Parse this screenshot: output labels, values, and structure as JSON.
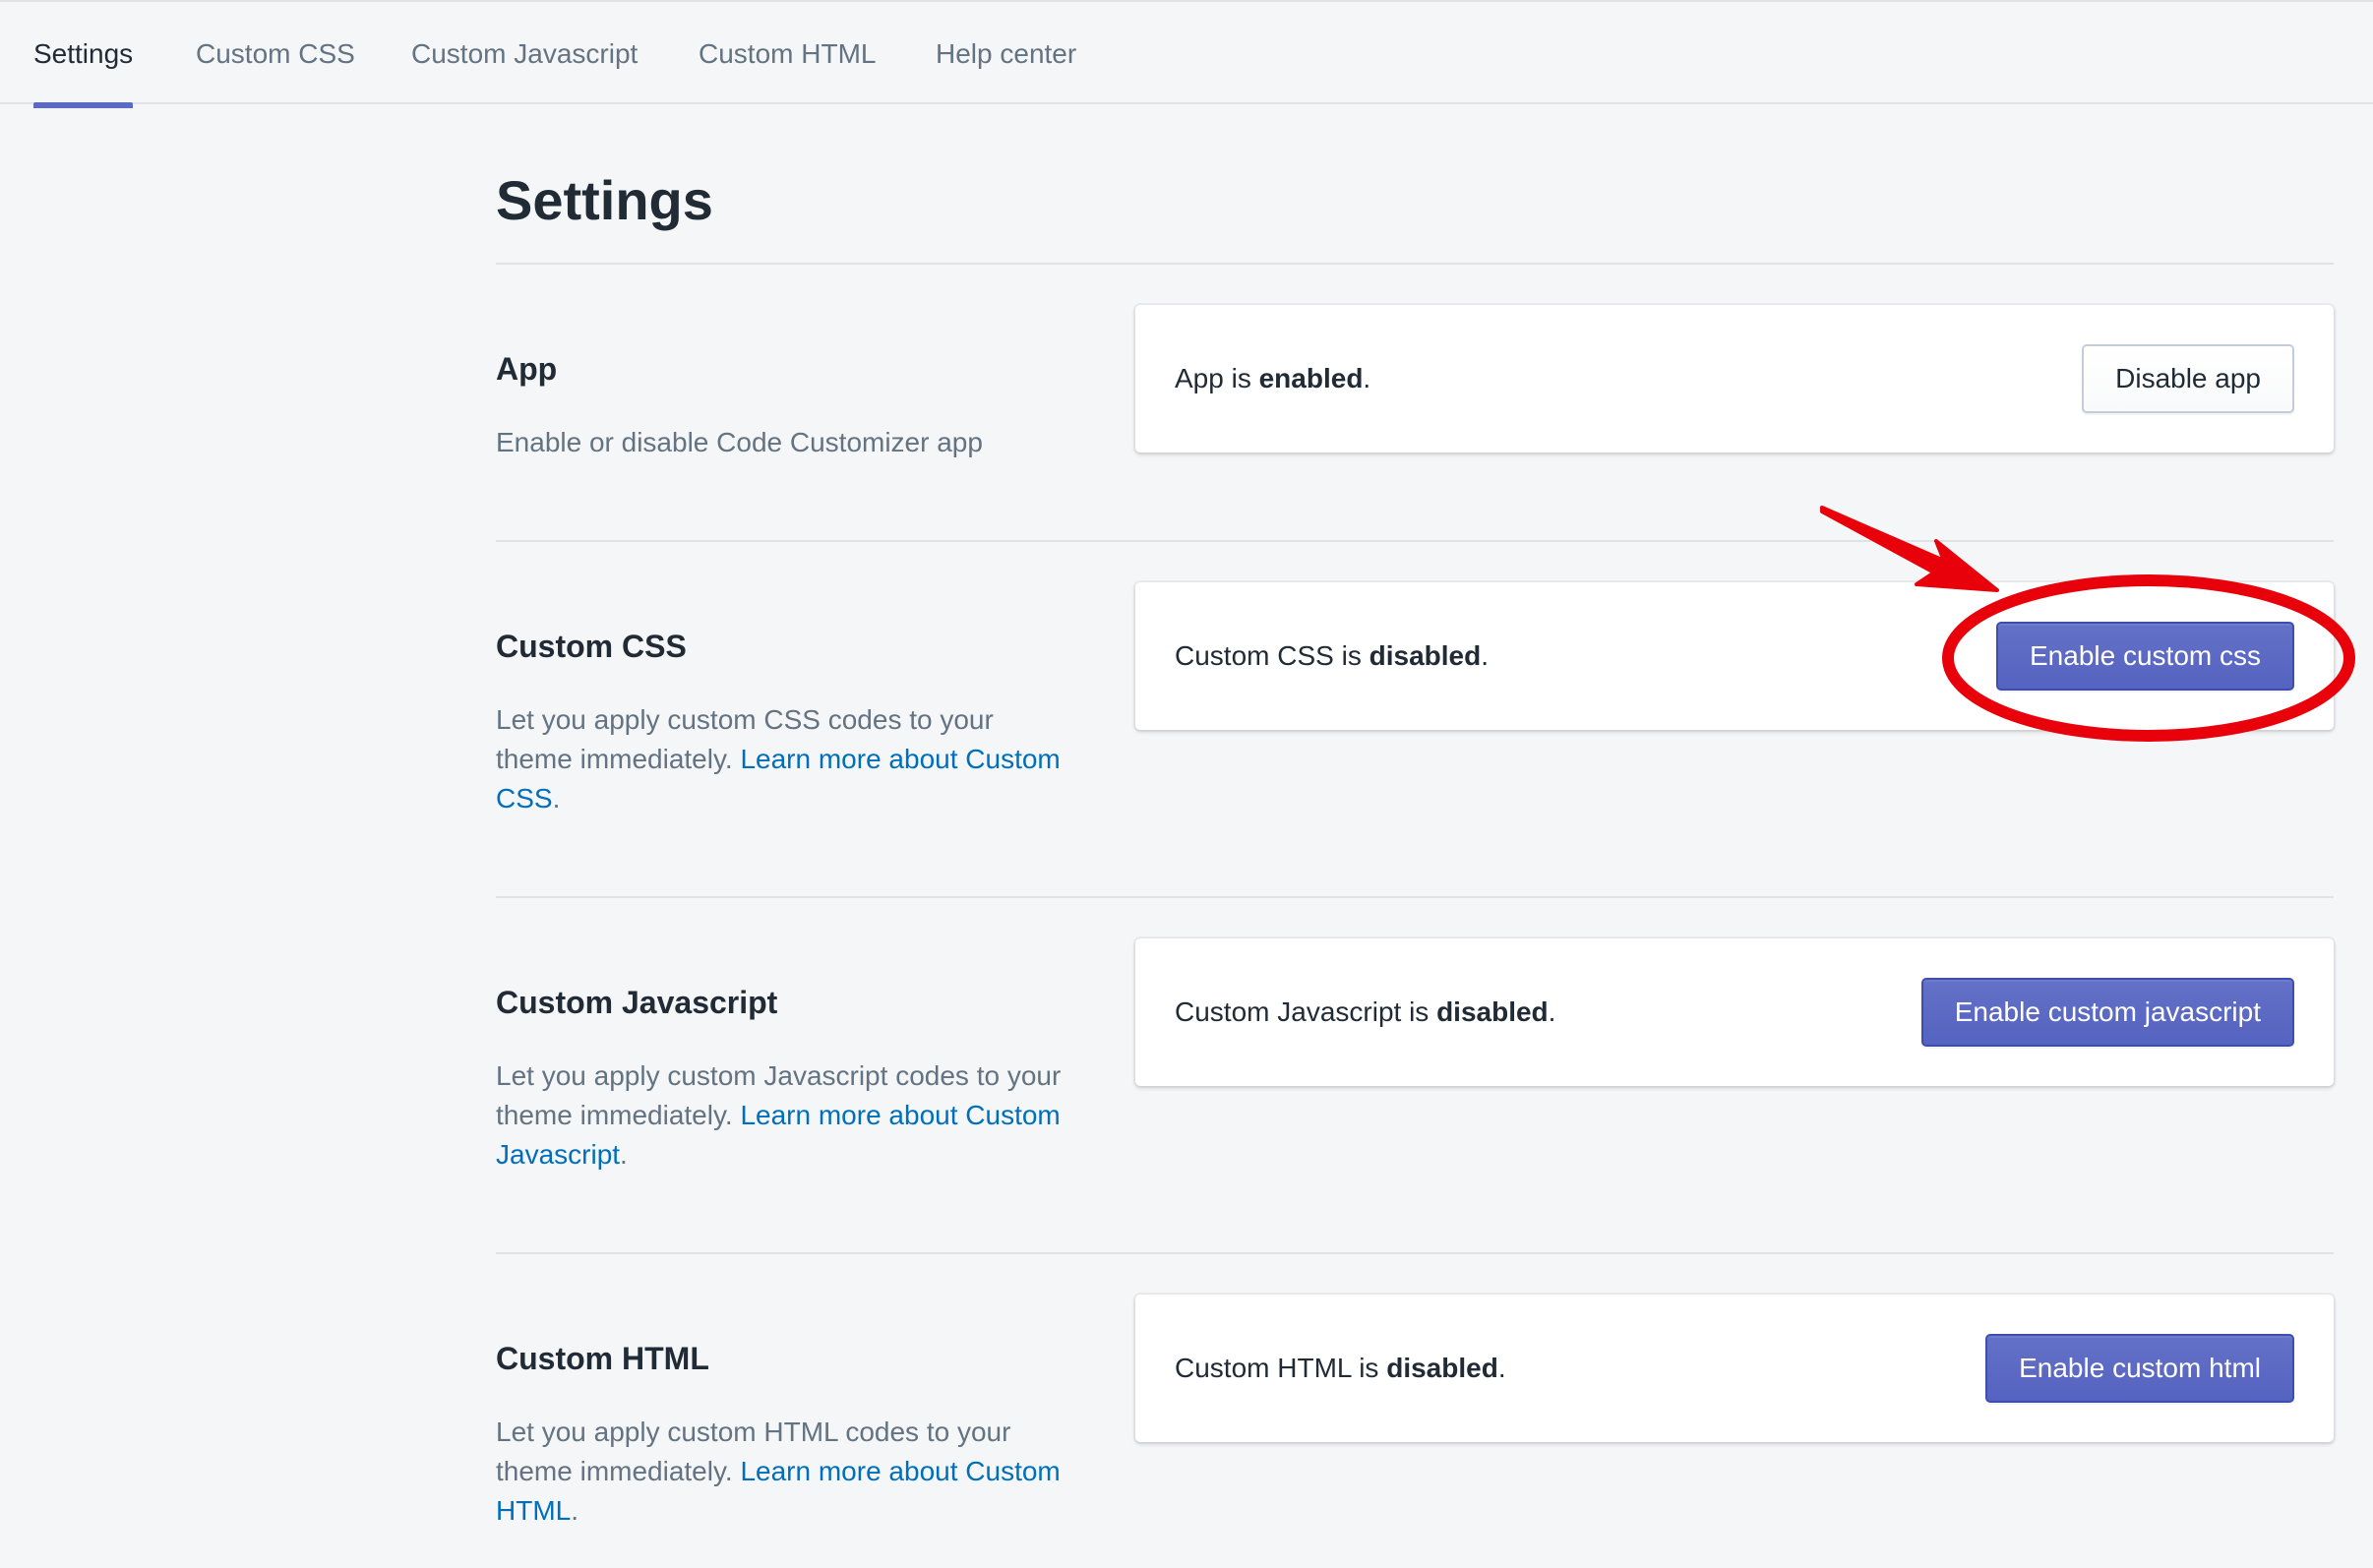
{
  "tabs": [
    {
      "label": "Settings",
      "active": true
    },
    {
      "label": "Custom CSS",
      "active": false
    },
    {
      "label": "Custom Javascript",
      "active": false
    },
    {
      "label": "Custom HTML",
      "active": false
    },
    {
      "label": "Help center",
      "active": false
    }
  ],
  "page_title": "Settings",
  "sections": {
    "app": {
      "title": "App",
      "description": "Enable or disable Code Customizer app",
      "status_prefix": "App is ",
      "status_value": "enabled",
      "status_suffix": ".",
      "button_label": "Disable app"
    },
    "css": {
      "title": "Custom CSS",
      "description": "Let you apply custom CSS codes to your theme immediately. ",
      "link": "Learn more about Custom CSS",
      "link_suffix": ".",
      "status_prefix": "Custom CSS is ",
      "status_value": "disabled",
      "status_suffix": ".",
      "button_label": "Enable custom css"
    },
    "js": {
      "title": "Custom Javascript",
      "description": "Let you apply custom Javascript codes to your theme immediately. ",
      "link": "Learn more about Custom Javascript",
      "link_suffix": ".",
      "status_prefix": "Custom Javascript is ",
      "status_value": "disabled",
      "status_suffix": ".",
      "button_label": "Enable custom javascript"
    },
    "html": {
      "title": "Custom HTML",
      "description": "Let you apply custom HTML codes to your theme immediately. ",
      "link": "Learn more about Custom HTML",
      "link_suffix": ".",
      "status_prefix": "Custom HTML is ",
      "status_value": "disabled",
      "status_suffix": ".",
      "button_label": "Enable custom html"
    }
  },
  "colors": {
    "accent": "#5c6ac4",
    "link": "#006fbb",
    "annotation": "#e8000b"
  }
}
